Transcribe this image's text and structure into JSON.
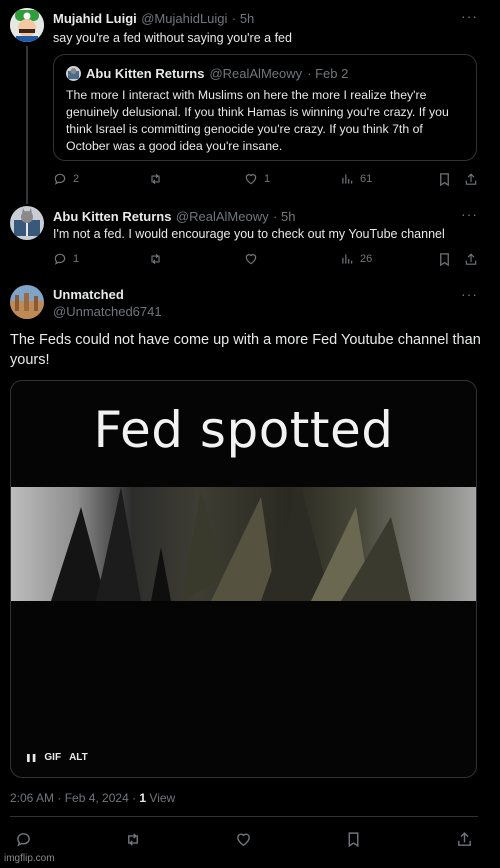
{
  "tweet1": {
    "name": "Mujahid Luigi",
    "handle": "@MujahidLuigi",
    "time": "· 5h",
    "text": "say you're a fed without saying you're a fed",
    "quote": {
      "name": "Abu Kitten Returns",
      "handle": "@RealAlMeowy",
      "time": "· Feb 2",
      "text": "The more I interact with Muslims on here the more I realize they're genuinely delusional. If you think Hamas is winning you're crazy. If you think Israel is committing genocide you're crazy. If you think 7th of October was a good idea you're insane."
    },
    "replies": "2",
    "retweets": "",
    "likes": "1",
    "views": "61"
  },
  "tweet2": {
    "name": "Abu Kitten Returns",
    "handle": "@RealAlMeowy",
    "time": "· 5h",
    "text": "I'm not a fed. I would encourage you to check out my YouTube channel",
    "replies": "1",
    "retweets": "",
    "likes": "",
    "views": "26"
  },
  "main": {
    "name": "Unmatched",
    "handle": "@Unmatched6741",
    "text": "The Feds could not have come up with a more Fed Youtube channel than yours!",
    "gif_caption": "Fed spotted",
    "gif_label": "GIF",
    "alt_label": "ALT",
    "pause_symbol": "❚❚",
    "timestamp": "2:06 AM · Feb 4, 2024 · ",
    "view_count": "1",
    "view_label": " View"
  },
  "watermark": "imgflip.com",
  "colors": {
    "background": "#000000",
    "text": "#e7e9ea",
    "muted": "#71767b",
    "border": "#2f3336"
  }
}
